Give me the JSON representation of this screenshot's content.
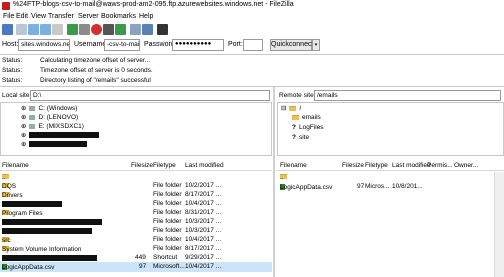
{
  "window": {
    "title": "%24FTP-blogs-csv-to-mail@waws-prod-am2-095.ftp.azurewebsites.windows.net - FileZilla"
  },
  "menu": [
    "File",
    "Edit",
    "View",
    "Transfer",
    "Server",
    "Bookmarks",
    "Help"
  ],
  "quickconnect": {
    "host_label": "Host:",
    "host_value": "sites.windows.net",
    "username_label": "Username:",
    "username_value": "-csv-to-mail",
    "password_label": "Password:",
    "password_value": "●●●●●●●●●●",
    "port_label": "Port:",
    "port_value": "",
    "button_label": "Quickconnect"
  },
  "log": [
    {
      "key": "Status:",
      "text": "Calculating timezone offset of server..."
    },
    {
      "key": "Status:",
      "text": "Timezone offset of server is 0 seconds."
    },
    {
      "key": "Status:",
      "text": "Directory listing of \"/emails\" successful"
    }
  ],
  "local": {
    "site_label": "Local site:",
    "site_value": "D:\\",
    "tree": [
      "C: (Windows)",
      "D: (LENOVO)",
      "E: (MIXSDXC1)"
    ],
    "columns": [
      "Filename",
      "Filesize",
      "Filetype",
      "Last modified"
    ],
    "files": [
      {
        "name": "..",
        "size": "",
        "type": "",
        "modified": ""
      },
      {
        "name": "DQS",
        "size": "",
        "type": "File folder",
        "modified": "10/2/2017 ..."
      },
      {
        "name": "Drivers",
        "size": "",
        "type": "File folder",
        "modified": "8/17/2017 ..."
      },
      {
        "name": "",
        "size": "",
        "type": "File folder",
        "modified": "10/4/2017 ..."
      },
      {
        "name": "Program Files",
        "size": "",
        "type": "File folder",
        "modified": "8/31/2017 ..."
      },
      {
        "name": "",
        "size": "",
        "type": "File folder",
        "modified": "10/3/2017 ..."
      },
      {
        "name": "",
        "size": "",
        "type": "File folder",
        "modified": "10/3/2017 ..."
      },
      {
        "name": "src",
        "size": "",
        "type": "File folder",
        "modified": "10/4/2017 ..."
      },
      {
        "name": "System Volume Information",
        "size": "",
        "type": "File folder",
        "modified": "8/17/2017 ..."
      },
      {
        "name": "",
        "size": "449",
        "type": "Shortcut",
        "modified": "9/29/2017 ..."
      },
      {
        "name": "LogicAppData.csv",
        "size": "97",
        "type": "Microsoft...",
        "modified": "10/4/2017 ..."
      }
    ]
  },
  "remote": {
    "site_label": "Remote site:",
    "site_value": "/emails",
    "tree": [
      "/",
      "emails",
      "LogFiles",
      "site"
    ],
    "columns": [
      "Filename",
      "Filesize",
      "Filetype",
      "Last modified",
      "Permis...",
      "Owner..."
    ],
    "files": [
      {
        "name": "..",
        "size": "",
        "type": "",
        "modified": ""
      },
      {
        "name": "LogicAppData.csv",
        "size": "97",
        "type": "Micros...",
        "modified": "10/8/201..."
      }
    ]
  }
}
